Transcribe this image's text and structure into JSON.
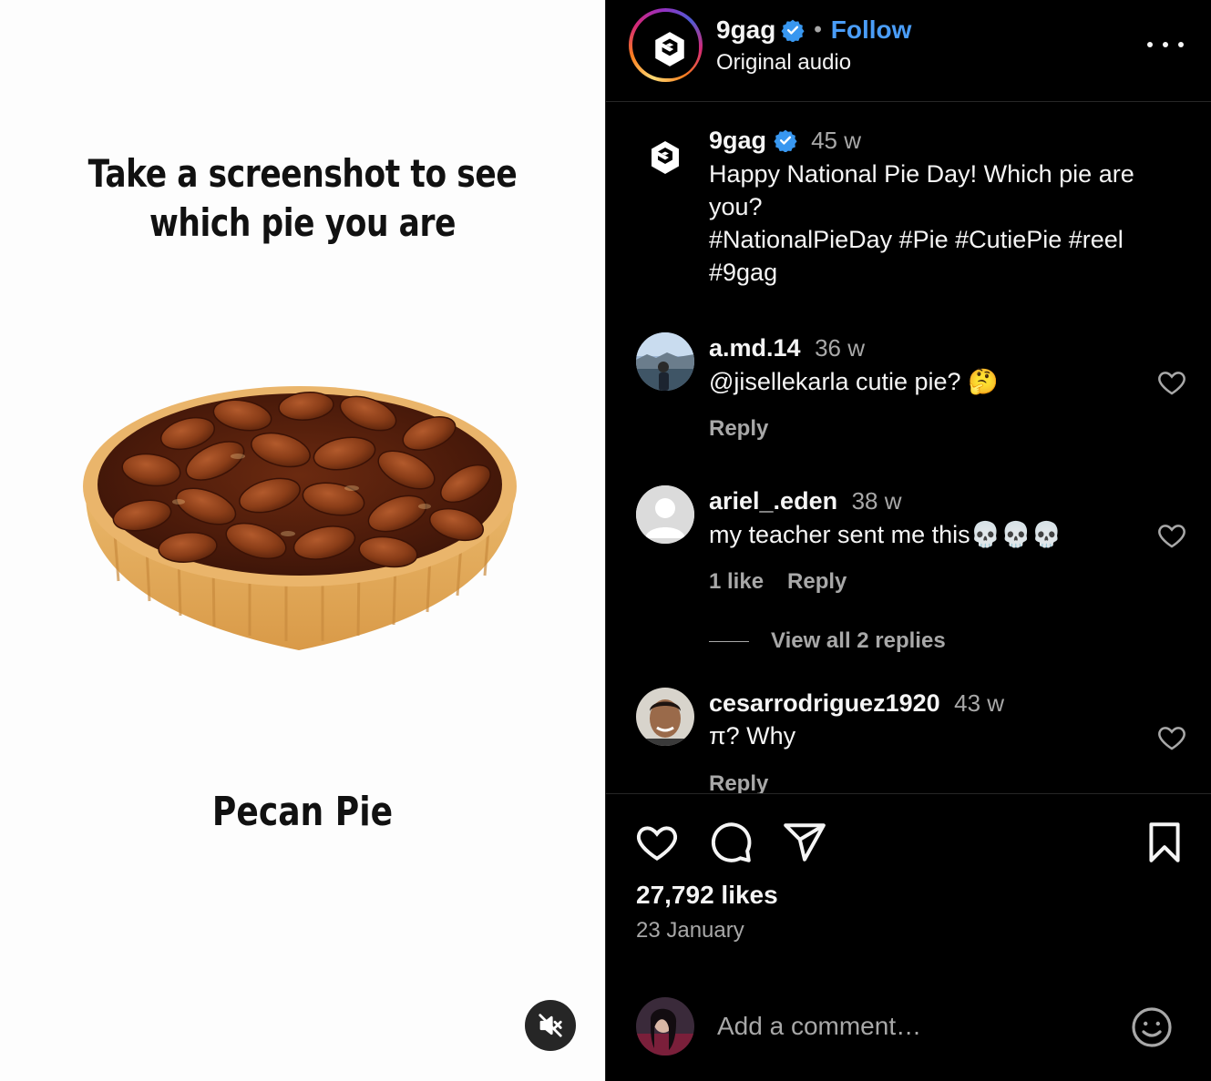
{
  "reel": {
    "headline_line1": "Take a screenshot to see",
    "headline_line2": "which pie you are",
    "caption": "Pecan Pie",
    "mute_icon": "speaker-muted-icon"
  },
  "header": {
    "username": "9gag",
    "separator": "•",
    "follow_label": "Follow",
    "audio": "Original audio",
    "more_icon": "more-horizontal-icon"
  },
  "post": {
    "username": "9gag",
    "time": "45 w",
    "caption_line1": "Happy National Pie Day! Which pie are",
    "caption_line2": "you?",
    "caption_line3": "#NationalPieDay #Pie #CutiePie #reel",
    "caption_line4": "#9gag"
  },
  "comments": [
    {
      "username": "a.md.14",
      "time": "36 w",
      "text": "@jisellekarla cutie pie? 🤔",
      "reply_label": "Reply"
    },
    {
      "username": "ariel_.eden",
      "time": "38 w",
      "text": "my teacher sent me this💀💀💀",
      "likes_label": "1 like",
      "reply_label": "Reply",
      "view_replies": "View all 2 replies"
    },
    {
      "username": "cesarrodriguez1920",
      "time": "43 w",
      "text": "π? Why",
      "reply_label": "Reply"
    }
  ],
  "footer": {
    "likes": "27,792 likes",
    "date": "23 January",
    "comment_placeholder": "Add a comment…"
  },
  "colors": {
    "background": "#000000",
    "text": "#f5f5f5",
    "muted": "#a8a8a8",
    "link": "#4a9df8",
    "verified": "#3897f0",
    "reel_bg": "#fdfdfd"
  }
}
